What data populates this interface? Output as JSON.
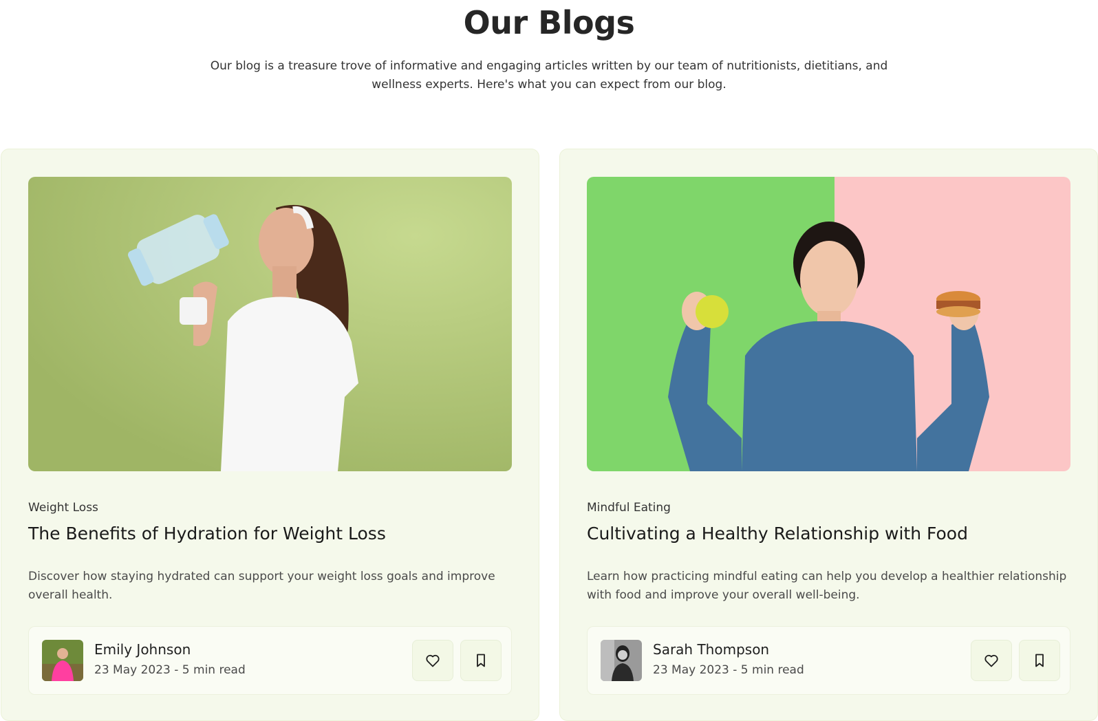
{
  "header": {
    "title": "Our Blogs",
    "subtitle": "Our blog is a treasure trove of informative and engaging articles written by our team of nutritionists, dietitians, and wellness experts. Here's what you can expect from our blog."
  },
  "posts": [
    {
      "category": "Weight Loss",
      "title": "The Benefits of Hydration for Weight Loss",
      "excerpt": "Discover how staying hydrated can support your weight loss goals and improve overall health.",
      "author": "Emily Johnson",
      "meta": "23 May 2023 - 5 min read",
      "image": "woman-drinking-water-photo",
      "avatar": "emily-avatar-photo"
    },
    {
      "category": "Mindful Eating",
      "title": "Cultivating a Healthy Relationship with Food",
      "excerpt": "Learn how practicing mindful eating can help you develop a healthier relationship with food and improve your overall well-being.",
      "author": "Sarah Thompson",
      "meta": "23 May 2023 - 5 min read",
      "image": "woman-apple-burger-photo",
      "avatar": "sarah-avatar-photo"
    }
  ],
  "icons": {
    "like": "heart-icon",
    "save": "bookmark-icon"
  },
  "colors": {
    "card_bg": "#f5f9eb",
    "author_box_bg": "#fafcf4",
    "button_bg": "#f3f8e6",
    "text_dark": "#1f1f1f"
  }
}
